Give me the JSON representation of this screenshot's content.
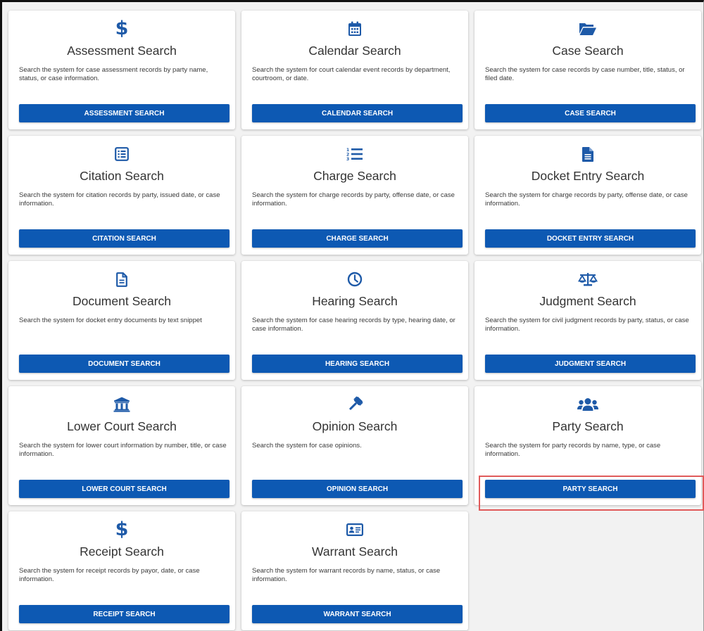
{
  "accent_color": "#0d59b3",
  "highlight_color": "#e05a5a",
  "cards": [
    {
      "icon": "dollar-icon",
      "title": "Assessment Search",
      "description": "Search the system for case assessment records by party name, status, or case information.",
      "button": "ASSESSMENT SEARCH"
    },
    {
      "icon": "calendar-icon",
      "title": "Calendar Search",
      "description": "Search the system for court calendar event records by department, courtroom, or date.",
      "button": "CALENDAR SEARCH"
    },
    {
      "icon": "folder-open-icon",
      "title": "Case Search",
      "description": "Search the system for case records by case number, title, status, or filed date.",
      "button": "CASE SEARCH"
    },
    {
      "icon": "list-box-icon",
      "title": "Citation Search",
      "description": "Search the system for citation records by party, issued date, or case information.",
      "button": "CITATION SEARCH"
    },
    {
      "icon": "numbered-list-icon",
      "title": "Charge Search",
      "description": "Search the system for charge records by party, offense date, or case information.",
      "button": "CHARGE SEARCH"
    },
    {
      "icon": "file-text-icon",
      "title": "Docket Entry Search",
      "description": "Search the system for charge records by party, offense date, or case information.",
      "button": "DOCKET ENTRY SEARCH"
    },
    {
      "icon": "document-outline-icon",
      "title": "Document Search",
      "description": "Search the system for docket entry documents by text snippet",
      "button": "DOCUMENT SEARCH"
    },
    {
      "icon": "clock-icon",
      "title": "Hearing Search",
      "description": "Search the system for case hearing records by type, hearing date, or case information.",
      "button": "HEARING SEARCH"
    },
    {
      "icon": "balance-scale-icon",
      "title": "Judgment Search",
      "description": "Search the system for civil judgment records by party, status, or case information.",
      "button": "JUDGMENT SEARCH"
    },
    {
      "icon": "courthouse-icon",
      "title": "Lower Court Search",
      "description": "Search the system for lower court information by number, title, or case information.",
      "button": "LOWER COURT SEARCH"
    },
    {
      "icon": "gavel-icon",
      "title": "Opinion Search",
      "description": "Search the system for case opinions.",
      "button": "OPINION SEARCH"
    },
    {
      "icon": "users-icon",
      "title": "Party Search",
      "description": "Search the system for party records by name, type, or case information.",
      "button": "PARTY SEARCH"
    },
    {
      "icon": "dollar-icon",
      "title": "Receipt Search",
      "description": "Search the system for receipt records by payor, date, or case information.",
      "button": "RECEIPT SEARCH"
    },
    {
      "icon": "id-card-icon",
      "title": "Warrant Search",
      "description": "Search the system for warrant records by name, status, or case information.",
      "button": "WARRANT SEARCH"
    }
  ]
}
